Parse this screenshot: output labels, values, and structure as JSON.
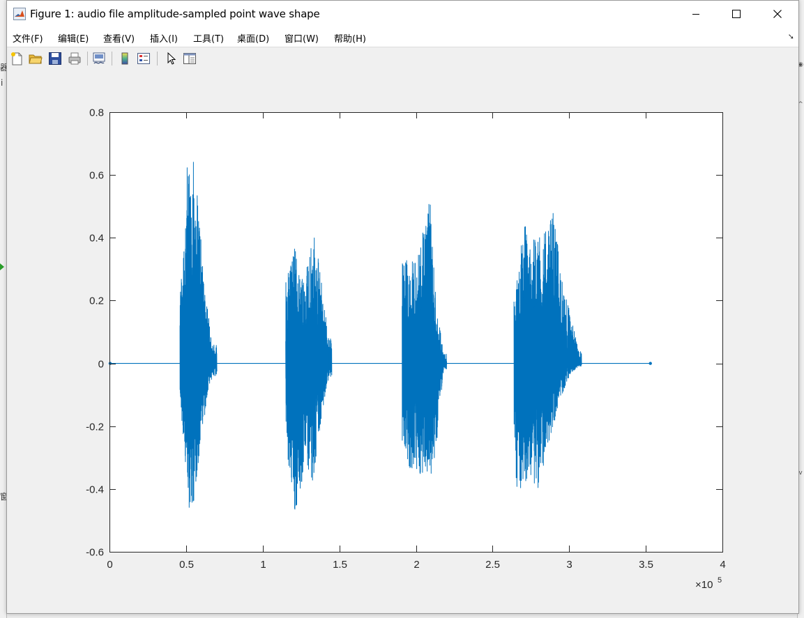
{
  "window": {
    "title": "Figure 1: audio file amplitude-sampled point wave shape"
  },
  "menu": {
    "items": [
      {
        "label": "文件(F)"
      },
      {
        "label": "编辑(E)"
      },
      {
        "label": "查看(V)"
      },
      {
        "label": "插入(I)"
      },
      {
        "label": "工具(T)"
      },
      {
        "label": "桌面(D)"
      },
      {
        "label": "窗口(W)"
      },
      {
        "label": "帮助(H)"
      }
    ]
  },
  "toolbar": {
    "buttons": [
      {
        "icon": "new-figure-icon"
      },
      {
        "icon": "open-file-icon"
      },
      {
        "icon": "save-icon"
      },
      {
        "icon": "print-icon"
      },
      {
        "icon": "link-plot-icon"
      },
      {
        "icon": "colorbar-icon"
      },
      {
        "icon": "legend-icon"
      },
      {
        "icon": "edit-plot-pointer-icon"
      },
      {
        "icon": "property-inspector-icon"
      }
    ]
  },
  "chart_data": {
    "type": "line",
    "title": "",
    "xlabel": "",
    "ylabel": "",
    "xlim": [
      0,
      4
    ],
    "ylim": [
      -0.6,
      0.8
    ],
    "x_exponent_label": "×10",
    "x_exponent": "5",
    "xticks": [
      "0",
      "0.5",
      "1",
      "1.5",
      "2",
      "2.5",
      "3",
      "3.5",
      "4"
    ],
    "yticks": [
      "-0.6",
      "-0.4",
      "-0.2",
      "0",
      "0.2",
      "0.4",
      "0.6",
      "0.8"
    ],
    "grid": false,
    "color": "#0072BD",
    "x_end": 3.53,
    "bursts": [
      {
        "x_start": 0.46,
        "x_end": 0.7,
        "peaks": [
          [
            0.46,
            0.22,
            -0.11
          ],
          [
            0.51,
            0.65,
            -0.45
          ],
          [
            0.54,
            0.68,
            -0.48
          ],
          [
            0.58,
            0.52,
            -0.33
          ],
          [
            0.625,
            0.25,
            -0.15
          ],
          [
            0.67,
            0.06,
            -0.04
          ]
        ]
      },
      {
        "x_start": 1.15,
        "x_end": 1.45,
        "peaks": [
          [
            1.15,
            0.29,
            -0.28
          ],
          [
            1.21,
            0.37,
            -0.48
          ],
          [
            1.27,
            0.28,
            -0.35
          ],
          [
            1.33,
            0.43,
            -0.38
          ],
          [
            1.38,
            0.28,
            -0.18
          ],
          [
            1.43,
            0.08,
            -0.05
          ]
        ]
      },
      {
        "x_start": 1.91,
        "x_end": 2.2,
        "peaks": [
          [
            1.92,
            0.34,
            -0.25
          ],
          [
            1.96,
            0.33,
            -0.35
          ],
          [
            2.02,
            0.35,
            -0.35
          ],
          [
            2.09,
            0.54,
            -0.37
          ],
          [
            2.13,
            0.21,
            -0.28
          ],
          [
            2.18,
            0.03,
            -0.02
          ]
        ]
      },
      {
        "x_start": 2.64,
        "x_end": 3.08,
        "peaks": [
          [
            2.65,
            0.22,
            -0.41
          ],
          [
            2.7,
            0.47,
            -0.41
          ],
          [
            2.75,
            0.37,
            -0.36
          ],
          [
            2.8,
            0.44,
            -0.41
          ],
          [
            2.85,
            0.42,
            -0.28
          ],
          [
            2.9,
            0.49,
            -0.19
          ],
          [
            2.96,
            0.24,
            -0.09
          ],
          [
            3.01,
            0.16,
            -0.03
          ],
          [
            3.06,
            0.04,
            -0.01
          ]
        ]
      }
    ]
  }
}
